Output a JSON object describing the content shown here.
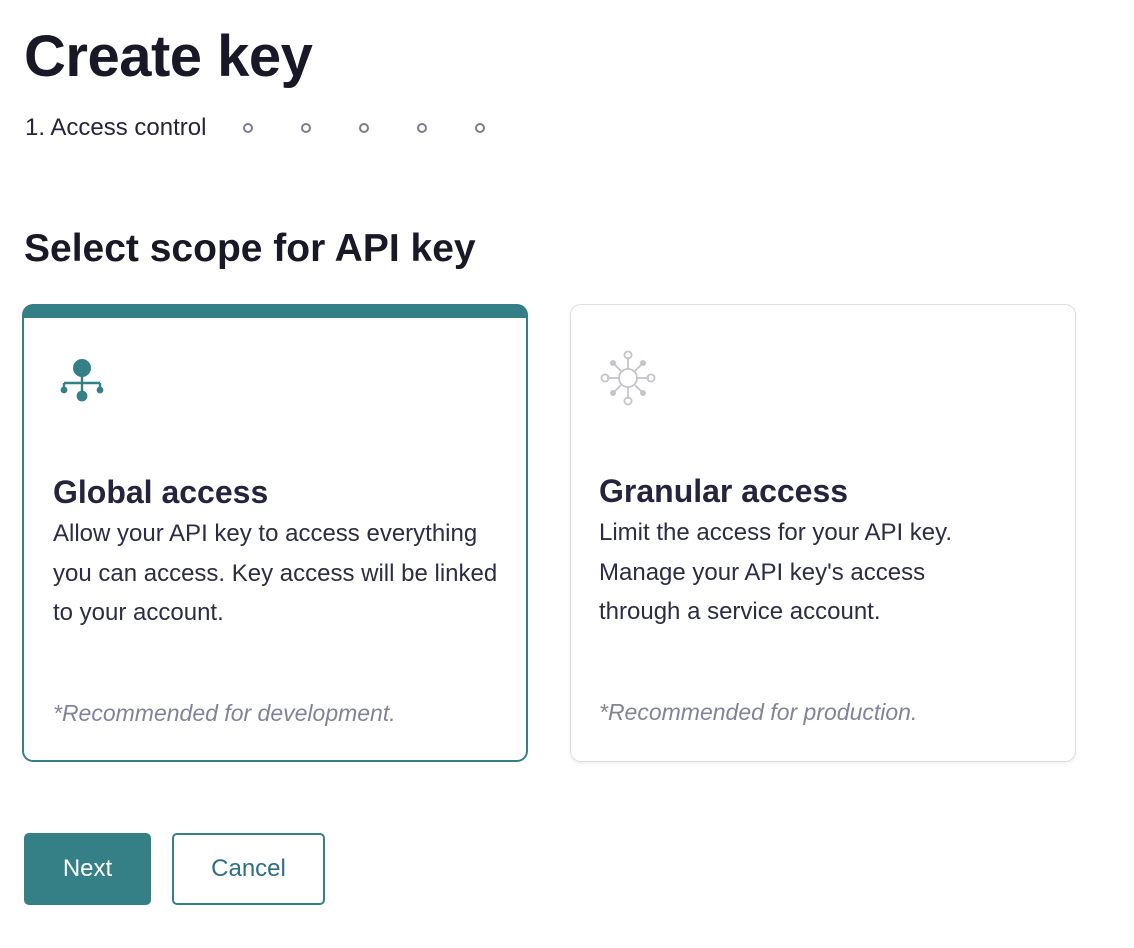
{
  "page": {
    "title": "Create key"
  },
  "stepper": {
    "current_step_label": "1. Access control",
    "remaining_steps": 5
  },
  "section": {
    "title": "Select scope for API key"
  },
  "cards": [
    {
      "id": "global",
      "selected": true,
      "icon": "hierarchy-icon",
      "title": "Global access",
      "description": "Allow your API key to access everything you can access. Key access will be linked to your account.",
      "note": "*Recommended for development."
    },
    {
      "id": "granular",
      "selected": false,
      "icon": "network-hub-icon",
      "title": "Granular access",
      "description": "Limit the access for your API key. Manage your API key's access through a service account.",
      "note": "*Recommended for production."
    }
  ],
  "actions": {
    "next_label": "Next",
    "cancel_label": "Cancel"
  },
  "colors": {
    "accent": "#357f86",
    "text": "#24243e",
    "muted": "#82839a",
    "step_dot": "#7b7c8f",
    "inactive_icon": "#c4c5cc"
  }
}
